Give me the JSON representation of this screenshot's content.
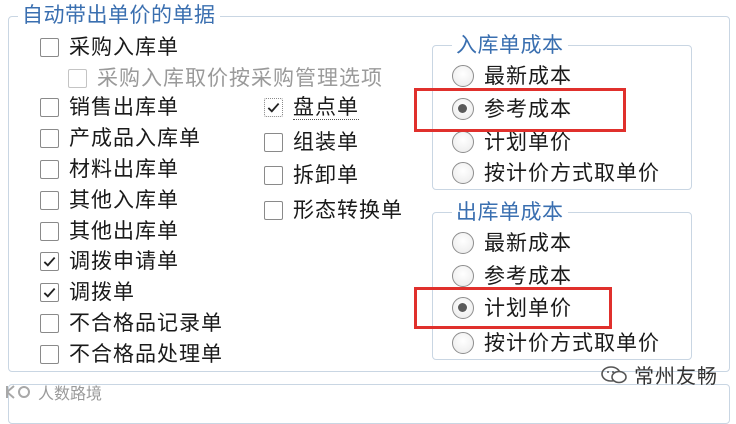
{
  "group": {
    "title": "自动带出单价的单据"
  },
  "left_column": [
    {
      "label": "采购入库单",
      "checked": false
    },
    {
      "label": "采购入库取价按采购管理选项",
      "checked": false,
      "disabled": true
    },
    {
      "label": "销售出库单",
      "checked": false
    },
    {
      "label": "产成品入库单",
      "checked": false
    },
    {
      "label": "材料出库单",
      "checked": false
    },
    {
      "label": "其他入库单",
      "checked": false
    },
    {
      "label": "其他出库单",
      "checked": false
    },
    {
      "label": "调拨申请单",
      "checked": true
    },
    {
      "label": "调拨单",
      "checked": true
    },
    {
      "label": "不合格品记录单",
      "checked": false
    },
    {
      "label": "不合格品处理单",
      "checked": false
    }
  ],
  "middle_column": [
    {
      "label": "盘点单",
      "checked": true
    },
    {
      "label": "组装单",
      "checked": false
    },
    {
      "label": "拆卸单",
      "checked": false
    },
    {
      "label": "形态转换单",
      "checked": false
    }
  ],
  "inbound_cost": {
    "title": "入库单成本",
    "options": [
      {
        "label": "最新成本",
        "selected": false
      },
      {
        "label": "参考成本",
        "selected": true
      },
      {
        "label": "计划单价",
        "selected": false
      },
      {
        "label": "按计价方式取单价",
        "selected": false
      }
    ]
  },
  "outbound_cost": {
    "title": "出库单成本",
    "options": [
      {
        "label": "最新成本",
        "selected": false
      },
      {
        "label": "参考成本",
        "selected": false
      },
      {
        "label": "计划单价",
        "selected": true
      },
      {
        "label": "按计价方式取单价",
        "selected": false
      }
    ]
  },
  "watermarks": {
    "left": "人数路境",
    "right": "常州友畅"
  },
  "colors": {
    "title_blue": "#3a6fb0",
    "highlight_red": "#e0302c",
    "frame_border": "#c9d6e3"
  }
}
